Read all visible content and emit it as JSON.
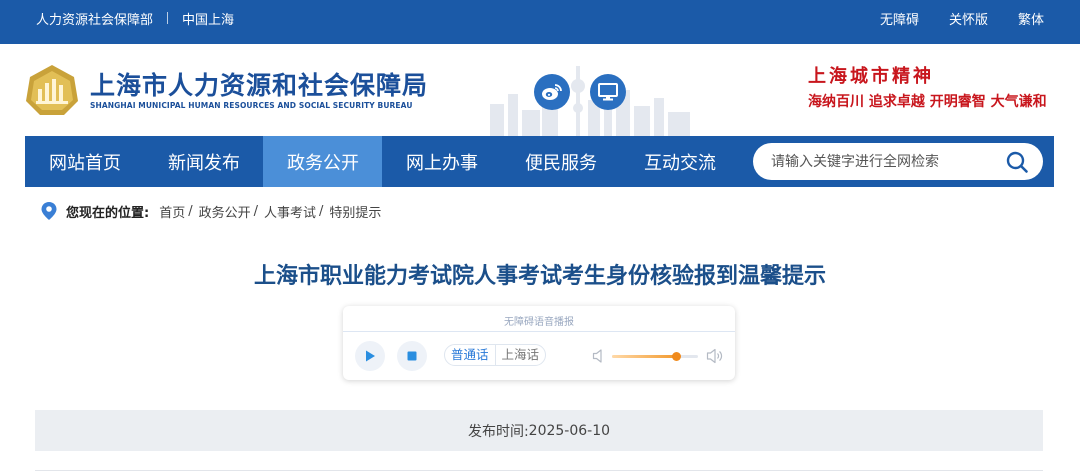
{
  "topbar": {
    "left_links": [
      "人力资源社会保障部",
      "中国上海"
    ],
    "right_links": [
      "无障碍",
      "关怀版",
      "繁体"
    ]
  },
  "header": {
    "site_name": "上海市人力资源和社会保障局",
    "site_name_en": "SHANGHAI MUNICIPAL HUMAN RESOURCES AND SOCIAL SECURITY BUREAU",
    "spirit_title": "上海城市精神",
    "spirit_motto": "海纳百川 追求卓越 开明睿智 大气谦和",
    "icons": [
      "weibo-icon",
      "computer-icon"
    ]
  },
  "nav": {
    "items": [
      "网站首页",
      "新闻发布",
      "政务公开",
      "网上办事",
      "便民服务",
      "互动交流"
    ],
    "active_index": 2,
    "search_placeholder": "请输入关键字进行全网检索"
  },
  "breadcrumb": {
    "prefix": "您现在的位置:",
    "items": [
      "首页",
      "政务公开",
      "人事考试",
      "特别提示"
    ],
    "separator": "/"
  },
  "article": {
    "title": "上海市职业能力考试院人事考试考生身份核验报到温馨提示",
    "publish_label": "发布时间:",
    "publish_date": "2025-06-10"
  },
  "player": {
    "label": "无障碍语音播报",
    "dialects": [
      "普通话",
      "上海话"
    ],
    "selected_dialect_index": 0,
    "volume_fraction": 0.75
  },
  "colors": {
    "primary_blue": "#1b5aa8",
    "active_nav": "#4b8fd8",
    "title_blue": "#1b4f8a",
    "spirit_red": "#c8161d",
    "volume_orange": "#f08a1c"
  }
}
